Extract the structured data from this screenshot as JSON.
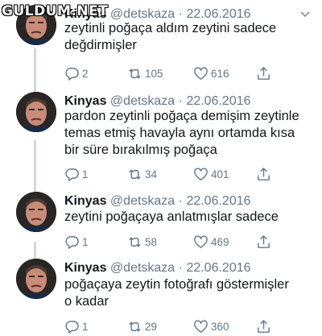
{
  "watermark": "GULDUM.NET",
  "tweets": [
    {
      "name": "Kinyas",
      "handle": "@detskaza",
      "separator": "·",
      "date": "22.06.2016",
      "lines": [
        "zeytinli poğaça aldım zeytini sadece",
        "değdirmişler"
      ],
      "replies": "2",
      "retweets": "105",
      "likes": "616"
    },
    {
      "name": "Kinyas",
      "handle": "@detskaza",
      "separator": "·",
      "date": "22.06.2016",
      "lines": [
        "pardon zeytinli poğaça demişim zeytinle",
        "temas etmiş havayla aynı ortamda kısa",
        "bir süre bırakılmış poğaça"
      ],
      "replies": "1",
      "retweets": "34",
      "likes": "401"
    },
    {
      "name": "Kinyas",
      "handle": "@detskaza",
      "separator": "·",
      "date": "22.06.2016",
      "lines": [
        "zeytini poğaçaya anlatmışlar sadece"
      ],
      "replies": "1",
      "retweets": "58",
      "likes": "469"
    },
    {
      "name": "Kinyas",
      "handle": "@detskaza",
      "separator": "·",
      "date": "22.06.2016",
      "lines": [
        "poğaçaya zeytin fotoğrafı göstermişler",
        "o kadar"
      ],
      "replies": "1",
      "retweets": "29",
      "likes": "360"
    }
  ],
  "icons": {
    "reply": "reply-icon",
    "retweet": "retweet-icon",
    "like": "heart-icon",
    "share": "share-icon",
    "menu": "chevron-down-icon",
    "avatar": "avatar-portrait"
  },
  "colors": {
    "text": "#14171a",
    "muted": "#657786",
    "thread_line": "#cfd9de"
  }
}
